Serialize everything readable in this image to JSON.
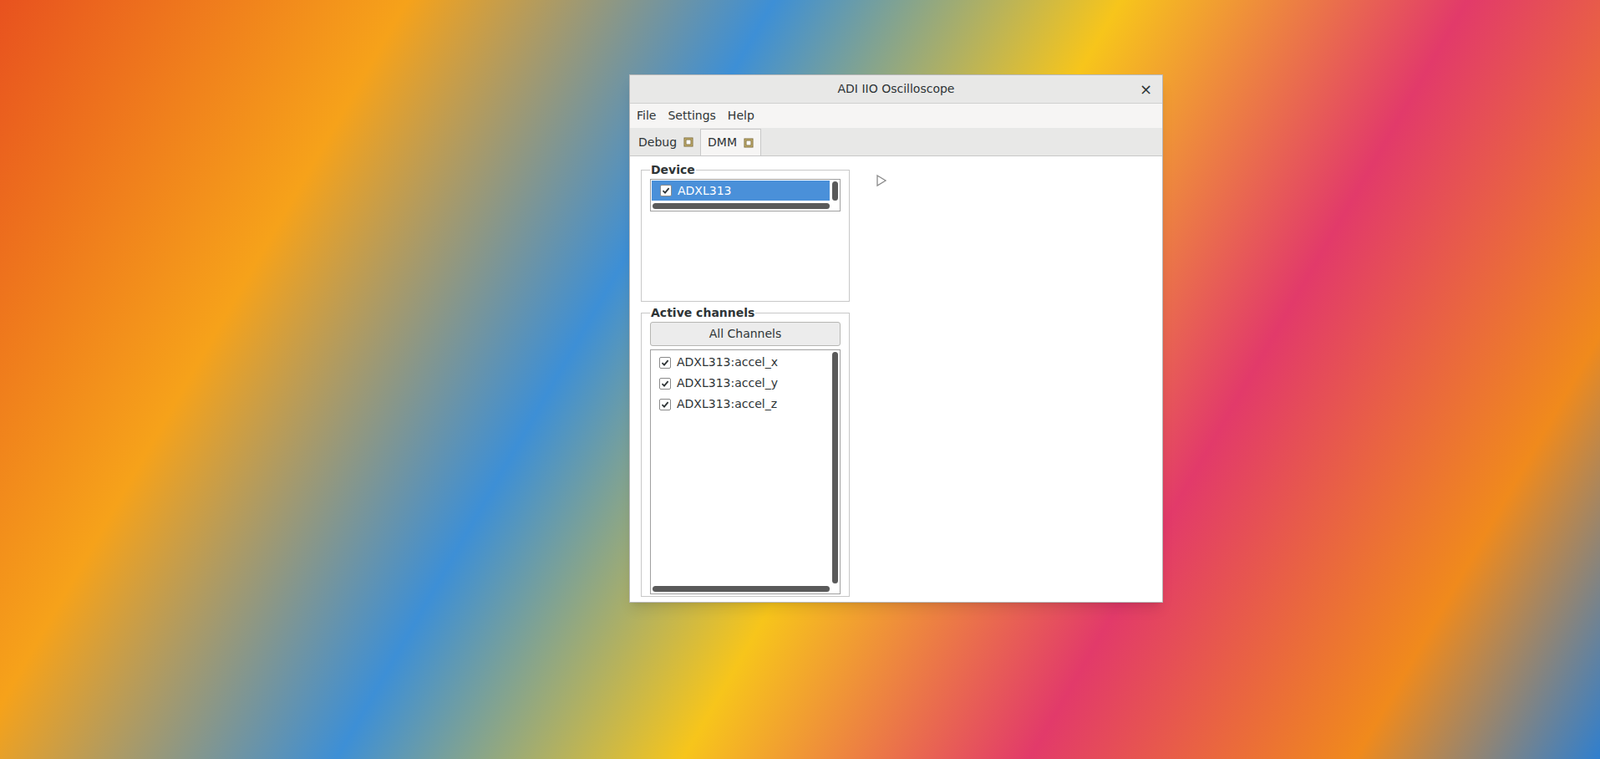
{
  "window": {
    "title": "ADI IIO Oscilloscope",
    "close": "×"
  },
  "menu": [
    "File",
    "Settings",
    "Help"
  ],
  "tabs": [
    {
      "label": "Debug",
      "selected": false
    },
    {
      "label": "DMM",
      "selected": true
    }
  ],
  "device_group": {
    "title": "Device",
    "devices": [
      {
        "name": "ADXL313",
        "checked": true,
        "selected": true
      }
    ]
  },
  "channels_group": {
    "title": "Active channels",
    "button": "All Channels",
    "channels": [
      {
        "name": "ADXL313:accel_x",
        "checked": true
      },
      {
        "name": "ADXL313:accel_y",
        "checked": true
      },
      {
        "name": "ADXL313:accel_z",
        "checked": true
      }
    ]
  }
}
